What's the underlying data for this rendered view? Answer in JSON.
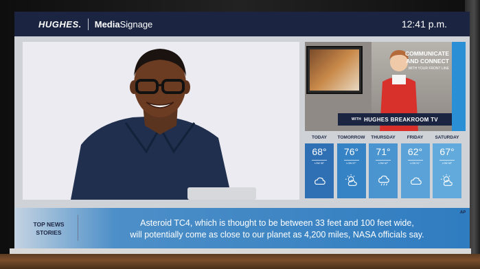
{
  "header": {
    "logo": "HUGHES.",
    "product_bold": "Media",
    "product_light": "Signage",
    "time": "12:41 p.m."
  },
  "promo": {
    "headline_line1": "COMMUNICATE",
    "headline_line2": "AND CONNECT",
    "subline": "WITH YOUR FRONT LINE",
    "band_prefix": "WITH",
    "band_text": "HUGHES BREAKROOM TV"
  },
  "weather": [
    {
      "day": "TODAY",
      "temp": "68°",
      "low": "LOW 56°",
      "icon": "cloud-icon",
      "color": "#2f6fb3"
    },
    {
      "day": "TOMORROW",
      "temp": "76°",
      "low": "LOW 67°",
      "icon": "sun-cloud-icon",
      "color": "#3583c4"
    },
    {
      "day": "THURSDAY",
      "temp": "71°",
      "low": "LOW 62°",
      "icon": "rain-cloud-icon",
      "color": "#4a95d0"
    },
    {
      "day": "FRIDAY",
      "temp": "62°",
      "low": "LOW 51°",
      "icon": "cloud-icon",
      "color": "#5aa2d8"
    },
    {
      "day": "SATURDAY",
      "temp": "67°",
      "low": "LOW 58°",
      "icon": "sun-cloud-icon",
      "color": "#63aadc"
    }
  ],
  "ticker": {
    "label_line1": "TOP NEWS",
    "label_line2": "STORIES",
    "headline_line1": "Asteroid TC4, which is thought to be between 33 feet and 100 feet wide,",
    "headline_line2": "will potentially come as close to our planet as 4,200 miles, NASA officials say.",
    "source": "AP"
  }
}
